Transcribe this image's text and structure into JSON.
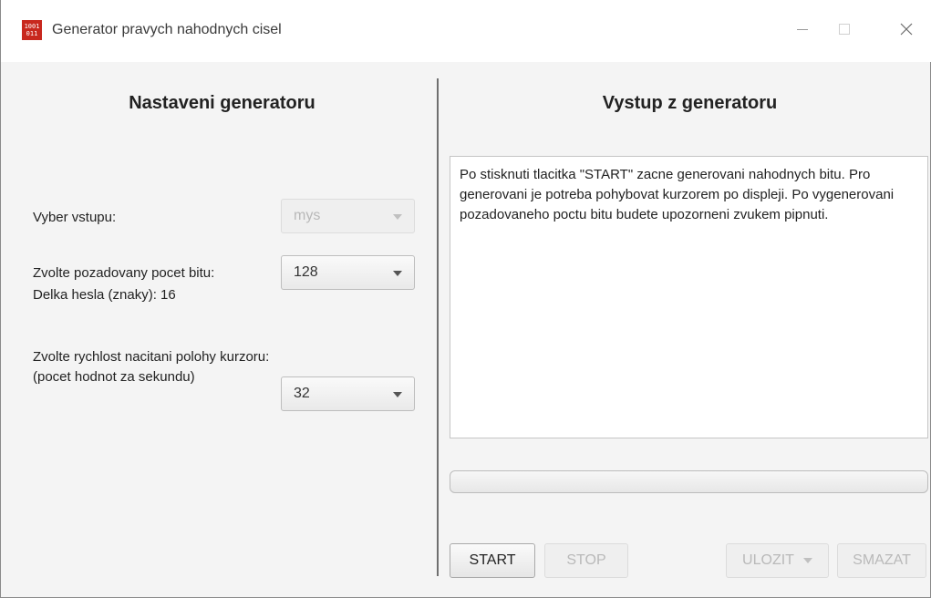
{
  "window": {
    "title": "Generator pravych nahodnych cisel",
    "icon_text": "1001 011",
    "controls": [
      "minimize",
      "maximize",
      "close"
    ]
  },
  "left": {
    "heading": "Nastaveni generatoru",
    "input_label": "Vyber vstupu:",
    "input_value": "mys",
    "bits_label": "Zvolte pozadovany pocet bitu:",
    "bits_value": "128",
    "password_length": "Delka hesla (znaky): 16",
    "speed_label": "Zvolte rychlost nacitani polohy kurzoru:",
    "speed_sublabel": "(pocet hodnot za sekundu)",
    "speed_value": "32"
  },
  "right": {
    "heading": "Vystup z generatoru",
    "output_text": "Po stisknuti tlacitka \"START\" zacne generovani nahodnych bitu. Pro generovani je potreba pohybovat kurzorem po displeji. Po vygenerovani pozadovaneho poctu bitu budete upozorneni zvukem pipnuti.",
    "progress": 0
  },
  "buttons": {
    "start": "START",
    "stop": "STOP",
    "save": "ULOZIT",
    "clear": "SMAZAT"
  },
  "colors": {
    "app_icon": "#c8281e",
    "divider": "#6f6f6f",
    "disabled_text": "#b9b9b9"
  }
}
